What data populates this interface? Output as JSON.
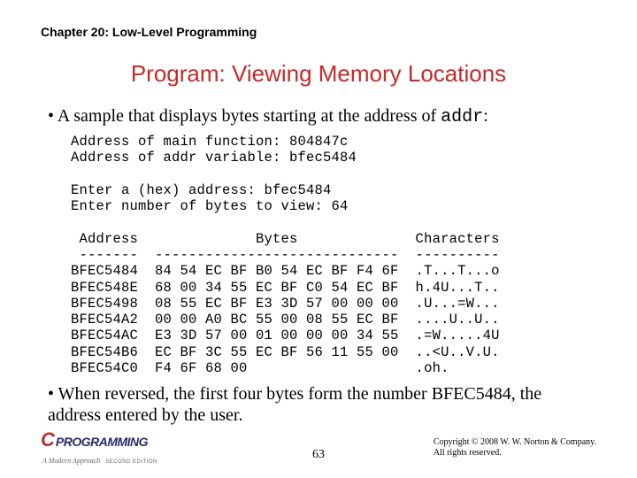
{
  "chapter": "Chapter 20: Low-Level Programming",
  "title": "Program: Viewing Memory Locations",
  "bullet1_pre": "A sample that displays bytes starting at the address of ",
  "bullet1_code": "addr",
  "bullet1_post": ":",
  "code": "Address of main function: 804847c\nAddress of addr variable: bfec5484\n\nEnter a (hex) address: bfec5484\nEnter number of bytes to view: 64\n\n Address              Bytes              Characters\n -------  -----------------------------  ----------\nBFEC5484  84 54 EC BF B0 54 EC BF F4 6F  .T...T...o\nBFEC548E  68 00 34 55 EC BF C0 54 EC BF  h.4U...T..\nBFEC5498  08 55 EC BF E3 3D 57 00 00 00  .U...=W...\nBFEC54A2  00 00 A0 BC 55 00 08 55 EC BF  ....U..U..\nBFEC54AC  E3 3D 57 00 01 00 00 00 34 55  .=W.....4U\nBFEC54B6  EC BF 3C 55 EC BF 56 11 55 00  ..<U..V.U.\nBFEC54C0  F4 6F 68 00                    .oh.",
  "bullet2": "When reversed, the first four bytes form the number BFEC5484, the address entered by the user.",
  "logo_c": "C",
  "logo_prog": "PROGRAMMING",
  "logo_sub1": "A Modern Approach",
  "logo_sub2": "SECOND EDITION",
  "page": "63",
  "copyright": "Copyright © 2008 W. W. Norton & Company.\nAll rights reserved."
}
